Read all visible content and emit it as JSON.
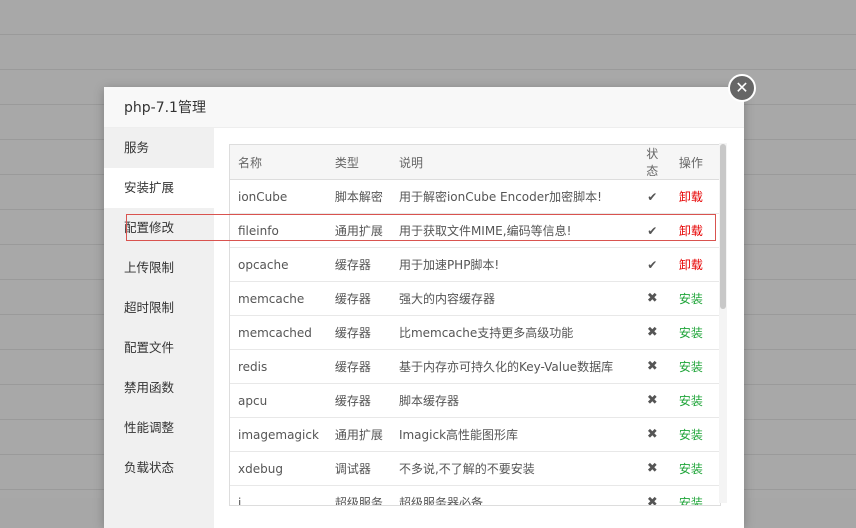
{
  "dialog": {
    "title": "php-7.1管理"
  },
  "close_icon": "close-icon",
  "sidebar": {
    "items": [
      {
        "label": "服务"
      },
      {
        "label": "安装扩展"
      },
      {
        "label": "配置修改"
      },
      {
        "label": "上传限制"
      },
      {
        "label": "超时限制"
      },
      {
        "label": "配置文件"
      },
      {
        "label": "禁用函数"
      },
      {
        "label": "性能调整"
      },
      {
        "label": "负载状态"
      }
    ],
    "active": "安装扩展"
  },
  "table": {
    "headers": {
      "name": "名称",
      "type": "类型",
      "desc": "说明",
      "status": "状态",
      "op": "操作"
    },
    "rows": [
      {
        "name": "ionCube",
        "type": "脚本解密",
        "desc": "用于解密ionCube Encoder加密脚本!",
        "status": "✔",
        "op": "卸载"
      },
      {
        "name": "fileinfo",
        "type": "通用扩展",
        "desc": "用于获取文件MIME,编码等信息!",
        "status": "✔",
        "op": "卸载"
      },
      {
        "name": "opcache",
        "type": "缓存器",
        "desc": "用于加速PHP脚本!",
        "status": "✔",
        "op": "卸载"
      },
      {
        "name": "memcache",
        "type": "缓存器",
        "desc": "强大的内容缓存器",
        "status": "✖",
        "op": "安装"
      },
      {
        "name": "memcached",
        "type": "缓存器",
        "desc": "比memcache支持更多高级功能",
        "status": "✖",
        "op": "安装"
      },
      {
        "name": "redis",
        "type": "缓存器",
        "desc": "基于内存亦可持久化的Key-Value数据库",
        "status": "✖",
        "op": "安装"
      },
      {
        "name": "apcu",
        "type": "缓存器",
        "desc": "脚本缓存器",
        "status": "✖",
        "op": "安装"
      },
      {
        "name": "imagemagick",
        "type": "通用扩展",
        "desc": "Imagick高性能图形库",
        "status": "✖",
        "op": "安装"
      },
      {
        "name": "xdebug",
        "type": "调试器",
        "desc": "不多说,不了解的不要安装",
        "status": "✖",
        "op": "安装"
      },
      {
        "name": "i...",
        "type": "超级服务",
        "desc": "超级服务器必备",
        "status": "✖",
        "op": "安装"
      }
    ]
  },
  "colors": {
    "uninstall": "#e60000",
    "install": "#20a53a",
    "highlight_border": "#d9534f"
  }
}
